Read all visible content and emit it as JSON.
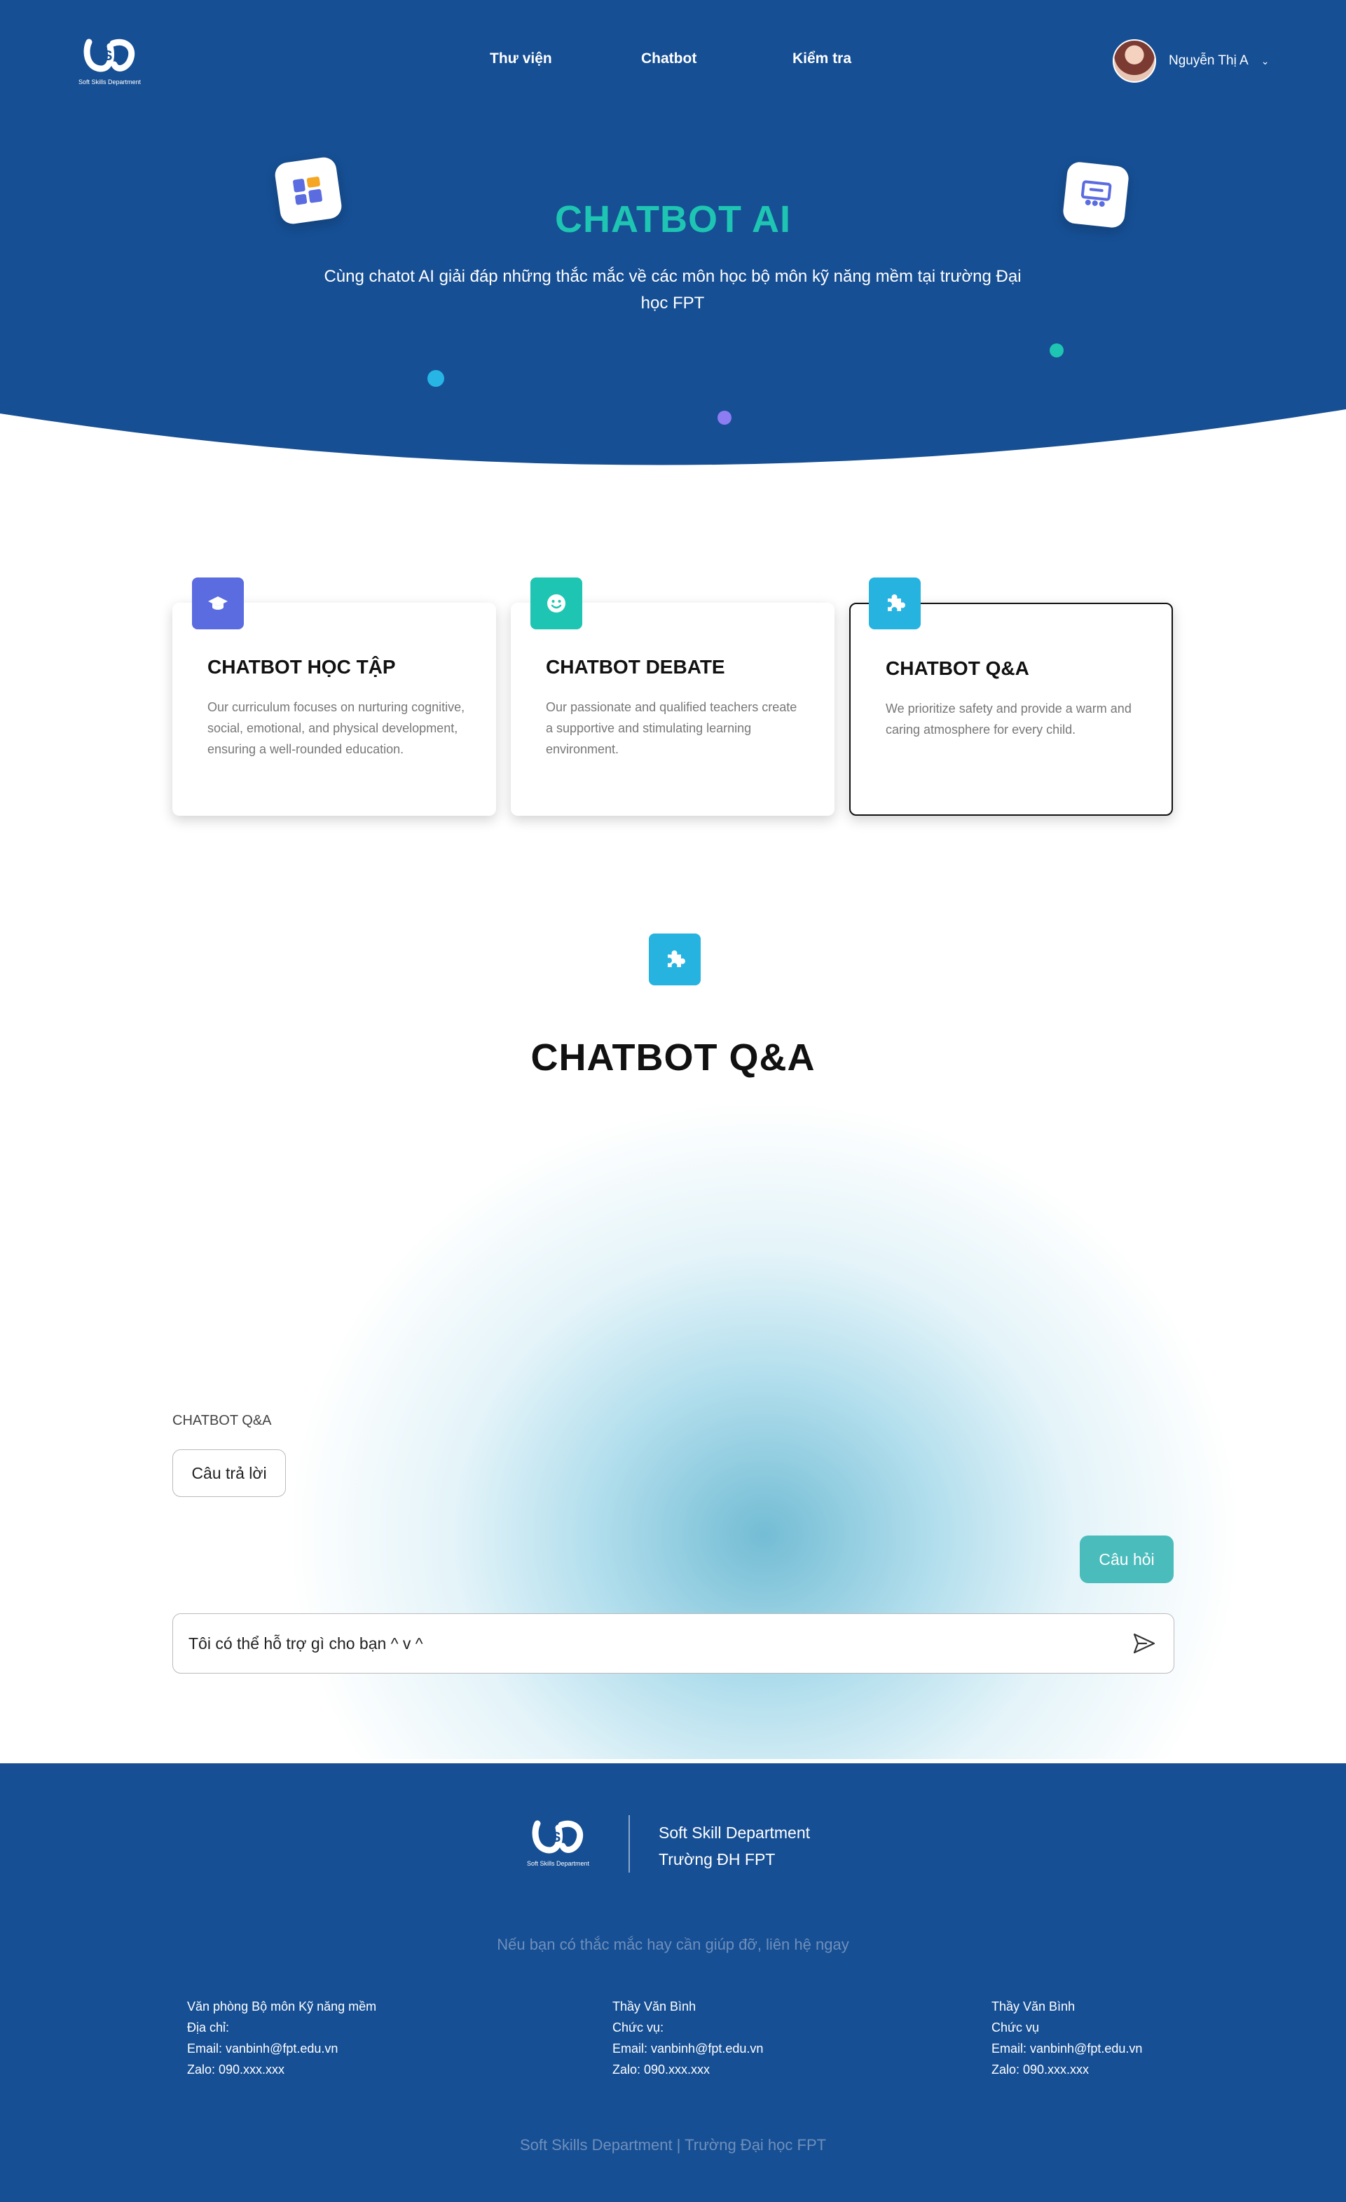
{
  "header": {
    "logo_caption": "Soft Skills Department",
    "nav": [
      "Thư viện",
      "Chatbot",
      "Kiểm tra"
    ],
    "user_name": "Nguyễn Thị A"
  },
  "hero": {
    "title": "CHATBOT AI",
    "subtitle": "Cùng chatot AI giải đáp những thắc mắc về các môn học bộ môn kỹ năng mềm tại trường Đại học FPT"
  },
  "cards": [
    {
      "title": "CHATBOT HỌC TẬP",
      "desc": "Our curriculum focuses on nurturing cognitive, social, emotional, and physical development, ensuring a well-rounded education.",
      "icon": "graduation-cap-icon",
      "color": "#5b6be0"
    },
    {
      "title": "CHATBOT DEBATE",
      "desc": "Our passionate and qualified teachers create a supportive and stimulating learning environment.",
      "icon": "smiley-icon",
      "color": "#1ec5b2"
    },
    {
      "title": "CHATBOT Q&A",
      "desc": "We prioritize safety and provide a warm and caring atmosphere for every child.",
      "icon": "puzzle-icon",
      "color": "#26b3e0"
    }
  ],
  "chat": {
    "section_title": "CHATBOT Q&A",
    "label": "CHATBOT Q&A",
    "answer": "Câu trả lời",
    "question": "Câu hỏi",
    "input_placeholder": "Tôi có thể hỗ trợ gì cho bạn ^ v ^"
  },
  "footer": {
    "logo_caption": "Soft Skills Department",
    "brand_line1": "Soft Skill Department",
    "brand_line2": "Trường ĐH FPT",
    "cta": "Nếu bạn có thắc mắc hay cần giúp đỡ, liên hệ ngay",
    "contacts": [
      [
        "Văn phòng Bộ môn Kỹ năng mềm",
        "Địa chỉ:",
        "Email: vanbinh@fpt.edu.vn",
        "Zalo: 090.xxx.xxx"
      ],
      [
        "Thầy Văn Bình",
        "Chức vụ:",
        "Email: vanbinh@fpt.edu.vn",
        "Zalo: 090.xxx.xxx"
      ],
      [
        "Thầy Văn Bình",
        "Chức vụ",
        "Email: vanbinh@fpt.edu.vn",
        "Zalo: 090.xxx.xxx"
      ]
    ],
    "copyright": "Soft Skills Department | Trường Đại học FPT"
  },
  "colors": {
    "primary_blue": "#164f94",
    "accent_teal": "#1ec5b2",
    "question_bubble": "#4bbcbc"
  }
}
